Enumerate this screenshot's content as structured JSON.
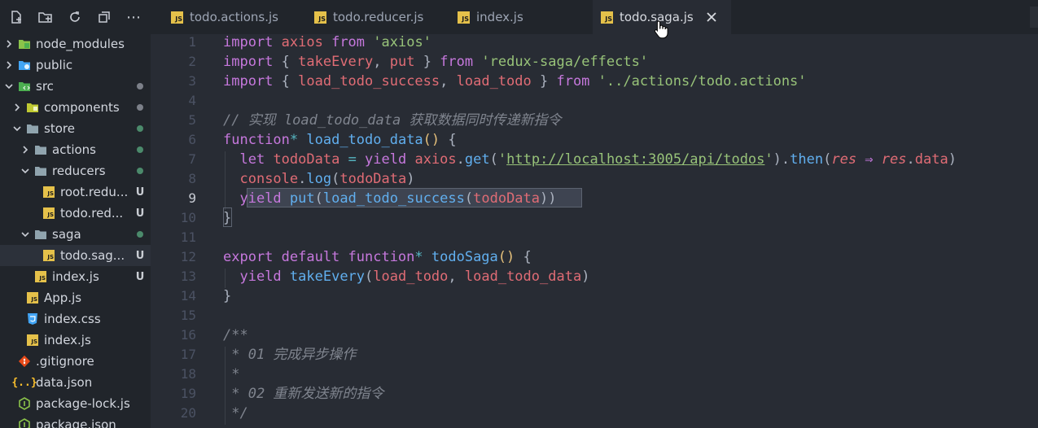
{
  "toolbar": {
    "icons": [
      "new-file-icon",
      "new-folder-icon",
      "refresh-icon",
      "collapse-icon",
      "more-icon"
    ],
    "more_label": "⋯"
  },
  "tabs": [
    {
      "label": "todo.actions.js",
      "active": false
    },
    {
      "label": "todo.reducer.js",
      "active": false
    },
    {
      "label": "index.js",
      "active": false
    },
    {
      "label": "todo.saga.js",
      "active": true
    }
  ],
  "js_badge": "JS",
  "explorer": [
    {
      "label": "node_modules",
      "depth": 0,
      "chevron": "right",
      "icon": "node-folder",
      "mark": "",
      "selected": false
    },
    {
      "label": "public",
      "depth": 0,
      "chevron": "right",
      "icon": "public-folder",
      "mark": "",
      "selected": false
    },
    {
      "label": "src",
      "depth": 0,
      "chevron": "down",
      "icon": "src-folder",
      "mark": "dot-grey",
      "selected": false
    },
    {
      "label": "components",
      "depth": 1,
      "chevron": "right",
      "icon": "components-folder",
      "mark": "dot-grey",
      "selected": false
    },
    {
      "label": "store",
      "depth": 1,
      "chevron": "down",
      "icon": "folder",
      "mark": "dot-green",
      "selected": false
    },
    {
      "label": "actions",
      "depth": 2,
      "chevron": "right",
      "icon": "folder",
      "mark": "dot-green",
      "selected": false
    },
    {
      "label": "reducers",
      "depth": 2,
      "chevron": "down",
      "icon": "folder",
      "mark": "dot-green",
      "selected": false
    },
    {
      "label": "root.redu...",
      "depth": 3,
      "chevron": "",
      "icon": "js-file",
      "mark": "U",
      "selected": false
    },
    {
      "label": "todo.red...",
      "depth": 3,
      "chevron": "",
      "icon": "js-file",
      "mark": "U",
      "selected": false
    },
    {
      "label": "saga",
      "depth": 2,
      "chevron": "down",
      "icon": "folder",
      "mark": "dot-green",
      "selected": false
    },
    {
      "label": "todo.sag...",
      "depth": 3,
      "chevron": "",
      "icon": "js-file",
      "mark": "U",
      "selected": true
    },
    {
      "label": "index.js",
      "depth": 2,
      "chevron": "",
      "icon": "js-file",
      "mark": "U",
      "selected": false
    },
    {
      "label": "App.js",
      "depth": 1,
      "chevron": "",
      "icon": "js-file",
      "mark": "",
      "selected": false
    },
    {
      "label": "index.css",
      "depth": 1,
      "chevron": "",
      "icon": "css-file",
      "mark": "",
      "selected": false
    },
    {
      "label": "index.js",
      "depth": 1,
      "chevron": "",
      "icon": "js-file",
      "mark": "",
      "selected": false
    },
    {
      "label": ".gitignore",
      "depth": 0,
      "chevron": "",
      "icon": "git-file",
      "mark": "",
      "selected": false
    },
    {
      "label": "data.json",
      "depth": 0,
      "chevron": "",
      "icon": "json-file",
      "mark": "",
      "selected": false
    },
    {
      "label": "package-lock.json",
      "depth": 0,
      "chevron": "",
      "icon": "node-file",
      "mark": "",
      "selected": false
    },
    {
      "label": "package.json",
      "depth": 0,
      "chevron": "",
      "icon": "node-file",
      "mark": "",
      "selected": false
    }
  ],
  "editor": {
    "current_line": 9,
    "line_numbers": [
      "1",
      "2",
      "3",
      "4",
      "5",
      "6",
      "7",
      "8",
      "9",
      "10",
      "11",
      "12",
      "13",
      "14",
      "15",
      "16",
      "17",
      "18",
      "19",
      "20"
    ],
    "lines": [
      [
        [
          "k",
          "import "
        ],
        [
          "v",
          "axios "
        ],
        [
          "k",
          "from "
        ],
        [
          "s",
          "'axios'"
        ]
      ],
      [
        [
          "k",
          "import "
        ],
        [
          "p",
          "{ "
        ],
        [
          "v",
          "takeEvery"
        ],
        [
          "p",
          ", "
        ],
        [
          "v",
          "put "
        ],
        [
          "p",
          "} "
        ],
        [
          "k",
          "from "
        ],
        [
          "s",
          "'redux-saga/effects'"
        ]
      ],
      [
        [
          "k",
          "import "
        ],
        [
          "p",
          "{ "
        ],
        [
          "v",
          "load_todo_success"
        ],
        [
          "p",
          ", "
        ],
        [
          "v",
          "load_todo "
        ],
        [
          "p",
          "} "
        ],
        [
          "k",
          "from "
        ],
        [
          "s",
          "'../actions/todo.actions'"
        ]
      ],
      [],
      [
        [
          "cm",
          "// 实现 load_todo_data 获取数据同时传递新指令"
        ]
      ],
      [
        [
          "k",
          "function"
        ],
        [
          "op",
          "* "
        ],
        [
          "f",
          "load_todo_data"
        ],
        [
          "y",
          "() "
        ],
        [
          "p",
          "{"
        ]
      ],
      [
        [
          "p",
          "  "
        ],
        [
          "k",
          "let "
        ],
        [
          "v",
          "todoData "
        ],
        [
          "op",
          "= "
        ],
        [
          "k",
          "yield "
        ],
        [
          "v",
          "axios"
        ],
        [
          "p",
          "."
        ],
        [
          "f",
          "get"
        ],
        [
          "p",
          "("
        ],
        [
          "s",
          "'"
        ],
        [
          "url",
          "http://localhost:3005/api/todos"
        ],
        [
          "s",
          "'"
        ],
        [
          "p",
          ")."
        ],
        [
          "f",
          "then"
        ],
        [
          "p",
          "("
        ],
        [
          "it",
          "res "
        ],
        [
          "k",
          "⇒ "
        ],
        [
          "it",
          "res"
        ],
        [
          "p",
          "."
        ],
        [
          "v",
          "data"
        ],
        [
          "p",
          ")"
        ]
      ],
      [
        [
          "p",
          "  "
        ],
        [
          "v",
          "console"
        ],
        [
          "p",
          "."
        ],
        [
          "f",
          "log"
        ],
        [
          "p",
          "("
        ],
        [
          "v",
          "todoData"
        ],
        [
          "p",
          ")"
        ]
      ],
      [
        [
          "p",
          "  "
        ],
        [
          "k",
          "yield "
        ],
        [
          "f",
          "put"
        ],
        [
          "p",
          "("
        ],
        [
          "f",
          "load_todo_success"
        ],
        [
          "p",
          "("
        ],
        [
          "v",
          "todoData"
        ],
        [
          "p",
          "))"
        ]
      ],
      [
        [
          "p",
          "}"
        ]
      ],
      [],
      [
        [
          "k",
          "export default function"
        ],
        [
          "op",
          "* "
        ],
        [
          "f",
          "todoSaga"
        ],
        [
          "y",
          "() "
        ],
        [
          "p",
          "{"
        ]
      ],
      [
        [
          "p",
          "  "
        ],
        [
          "k",
          "yield "
        ],
        [
          "f",
          "takeEvery"
        ],
        [
          "p",
          "("
        ],
        [
          "v",
          "load_todo"
        ],
        [
          "p",
          ", "
        ],
        [
          "v",
          "load_todo_data"
        ],
        [
          "p",
          ")"
        ]
      ],
      [
        [
          "p",
          "}"
        ]
      ],
      [],
      [
        [
          "cm",
          "/**"
        ]
      ],
      [
        [
          "cm",
          " * 01 完成异步操作"
        ]
      ],
      [
        [
          "cm",
          " *"
        ]
      ],
      [
        [
          "cm",
          " * 02 重新发送新的指令"
        ]
      ],
      [
        [
          "cm",
          " */"
        ]
      ]
    ]
  },
  "colors": {
    "bg_editor": "#282c34",
    "bg_sidebar": "#21252b",
    "keyword": "#c678dd",
    "string": "#98c379",
    "function": "#61afef",
    "variable": "#e06c75",
    "comment": "#7f848e"
  }
}
